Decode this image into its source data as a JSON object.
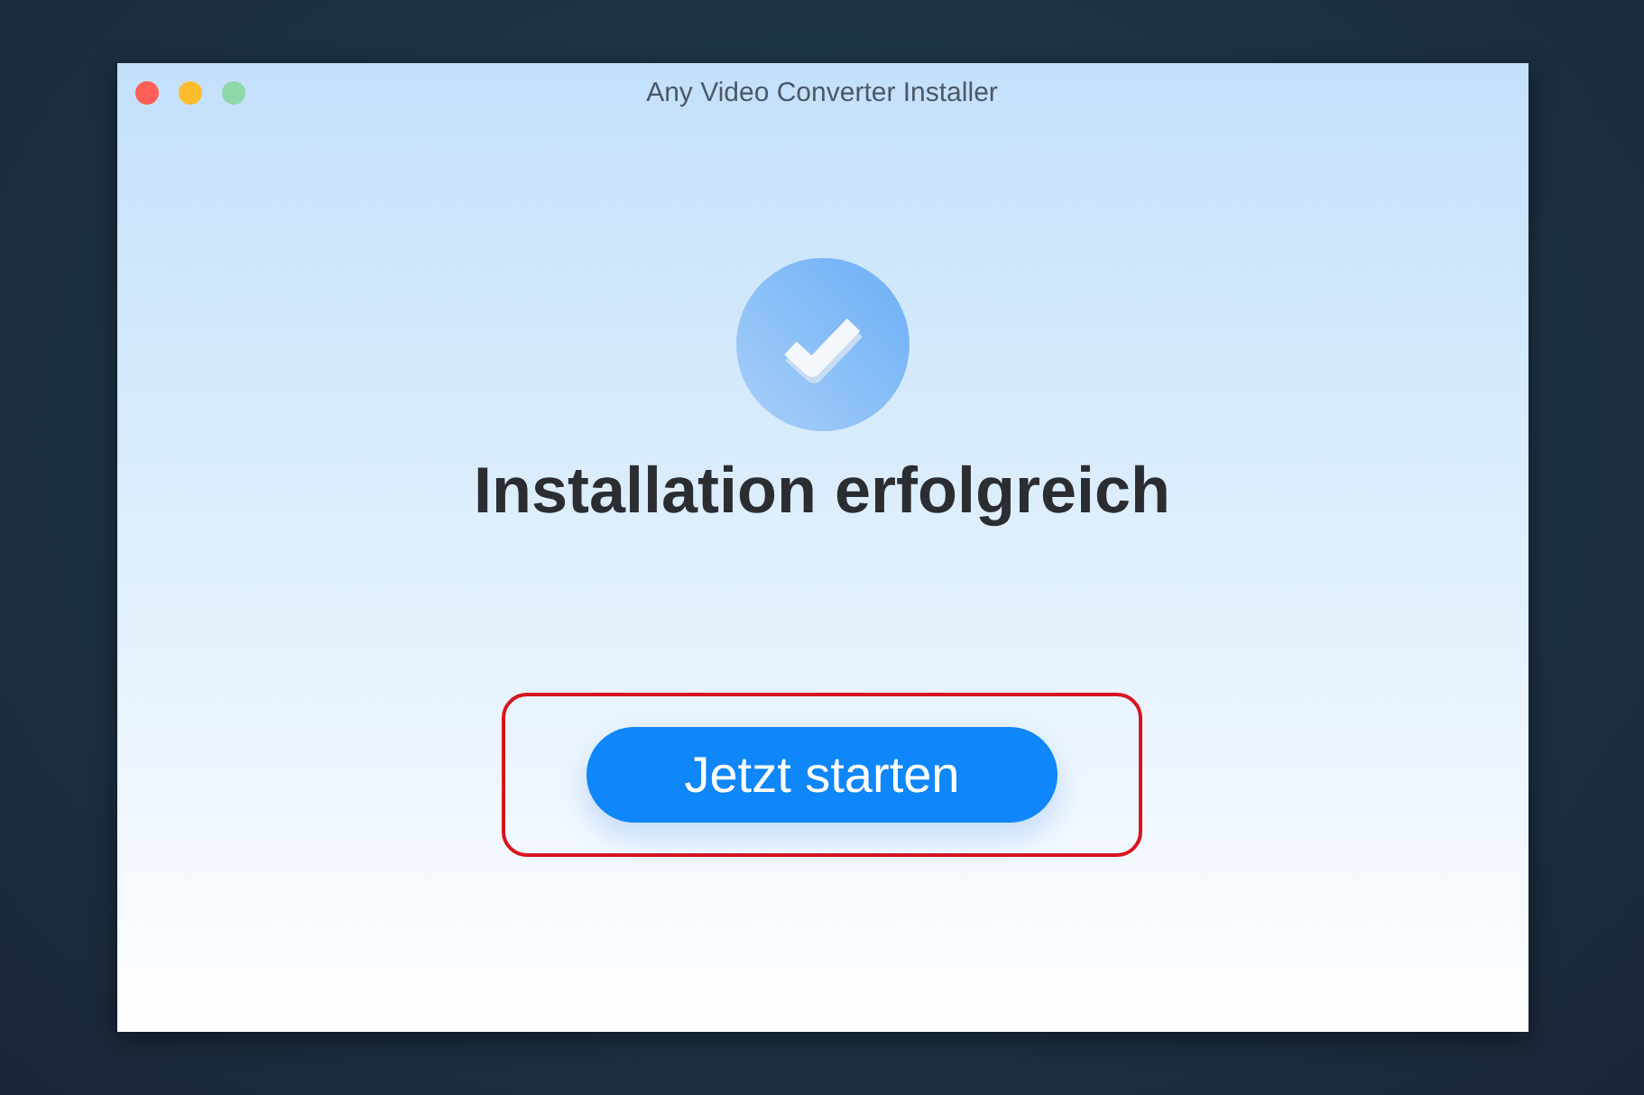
{
  "window": {
    "title": "Any Video Converter Installer",
    "controls": [
      {
        "color": "#fe5f57"
      },
      {
        "color": "#fdbc2e"
      },
      {
        "color": "#8fd6a8"
      }
    ]
  },
  "status": {
    "kind": "success",
    "heading": "Installation erfolgreich"
  },
  "button": {
    "label": "Jetzt starten",
    "highlighted": true
  }
}
